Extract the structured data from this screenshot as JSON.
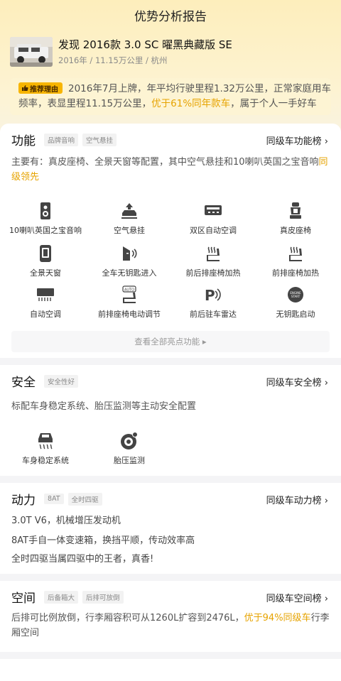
{
  "header": {
    "title": "优势分析报告"
  },
  "car": {
    "name": "发现 2016款 3.0 SC 曜黑典藏版 SE",
    "meta": "2016年 / 11.15万公里 / 杭州"
  },
  "reason": {
    "badge": "推荐理由",
    "text_a": "2016年7月上牌，年平均行驶里程1.32万公里，正常家庭用车频率，表显里程11.15万公里，",
    "highlight": "优于61%同年款车",
    "text_b": "，属于个人一手好车"
  },
  "function": {
    "title": "功能",
    "tags": [
      "品牌音响",
      "空气悬挂"
    ],
    "rank": "同级车功能榜 ›",
    "desc_a": "主要有：真皮座椅、全景天窗等配置，其中空气悬挂和10喇叭英国之宝音响",
    "desc_hl": "同级领先",
    "features": [
      {
        "label": "10喇叭英国之宝音响",
        "icon": "speaker-icon"
      },
      {
        "label": "空气悬挂",
        "icon": "air-suspension-icon"
      },
      {
        "label": "双区自动空调",
        "icon": "climate-icon"
      },
      {
        "label": "真皮座椅",
        "icon": "leather-seat-icon"
      },
      {
        "label": "全景天窗",
        "icon": "sunroof-icon"
      },
      {
        "label": "全车无钥匙进入",
        "icon": "keyless-entry-icon"
      },
      {
        "label": "前后排座椅加热",
        "icon": "seat-heat-icon"
      },
      {
        "label": "前排座椅加热",
        "icon": "seat-heat-icon"
      },
      {
        "label": "自动空调",
        "icon": "auto-ac-icon"
      },
      {
        "label": "前排座椅电动调节",
        "icon": "power-seat-icon"
      },
      {
        "label": "前后驻车雷达",
        "icon": "parking-radar-icon"
      },
      {
        "label": "无钥匙启动",
        "icon": "start-button-icon"
      }
    ],
    "more": "查看全部亮点功能 ▸"
  },
  "safety": {
    "title": "安全",
    "tags": [
      "安全性好"
    ],
    "rank": "同级车安全榜 ›",
    "desc": "标配车身稳定系统、胎压监测等主动安全配置",
    "features": [
      {
        "label": "车身稳定系统",
        "icon": "esp-icon"
      },
      {
        "label": "胎压监测",
        "icon": "tire-pressure-icon"
      }
    ]
  },
  "power": {
    "title": "动力",
    "tags": [
      "8AT",
      "全时四驱"
    ],
    "rank": "同级车动力榜 ›",
    "lines": [
      "3.0T V6，机械增压发动机",
      "8AT手自一体变速箱，换挡平顺，传动效率高",
      "全时四驱当属四驱中的王者，真香!"
    ]
  },
  "space": {
    "title": "空间",
    "tags": [
      "后备箱大",
      "后排可放倒"
    ],
    "rank": "同级车空间榜 ›",
    "desc_a": "后排可比例放倒，行李厢容积可从1260L扩容到2476L，",
    "desc_hl": "优于94%同级车",
    "desc_b": "行李厢空间"
  },
  "colors": {
    "accent": "#e6a300",
    "badge": "#f7b500",
    "top_bg": "#fdeebc"
  }
}
